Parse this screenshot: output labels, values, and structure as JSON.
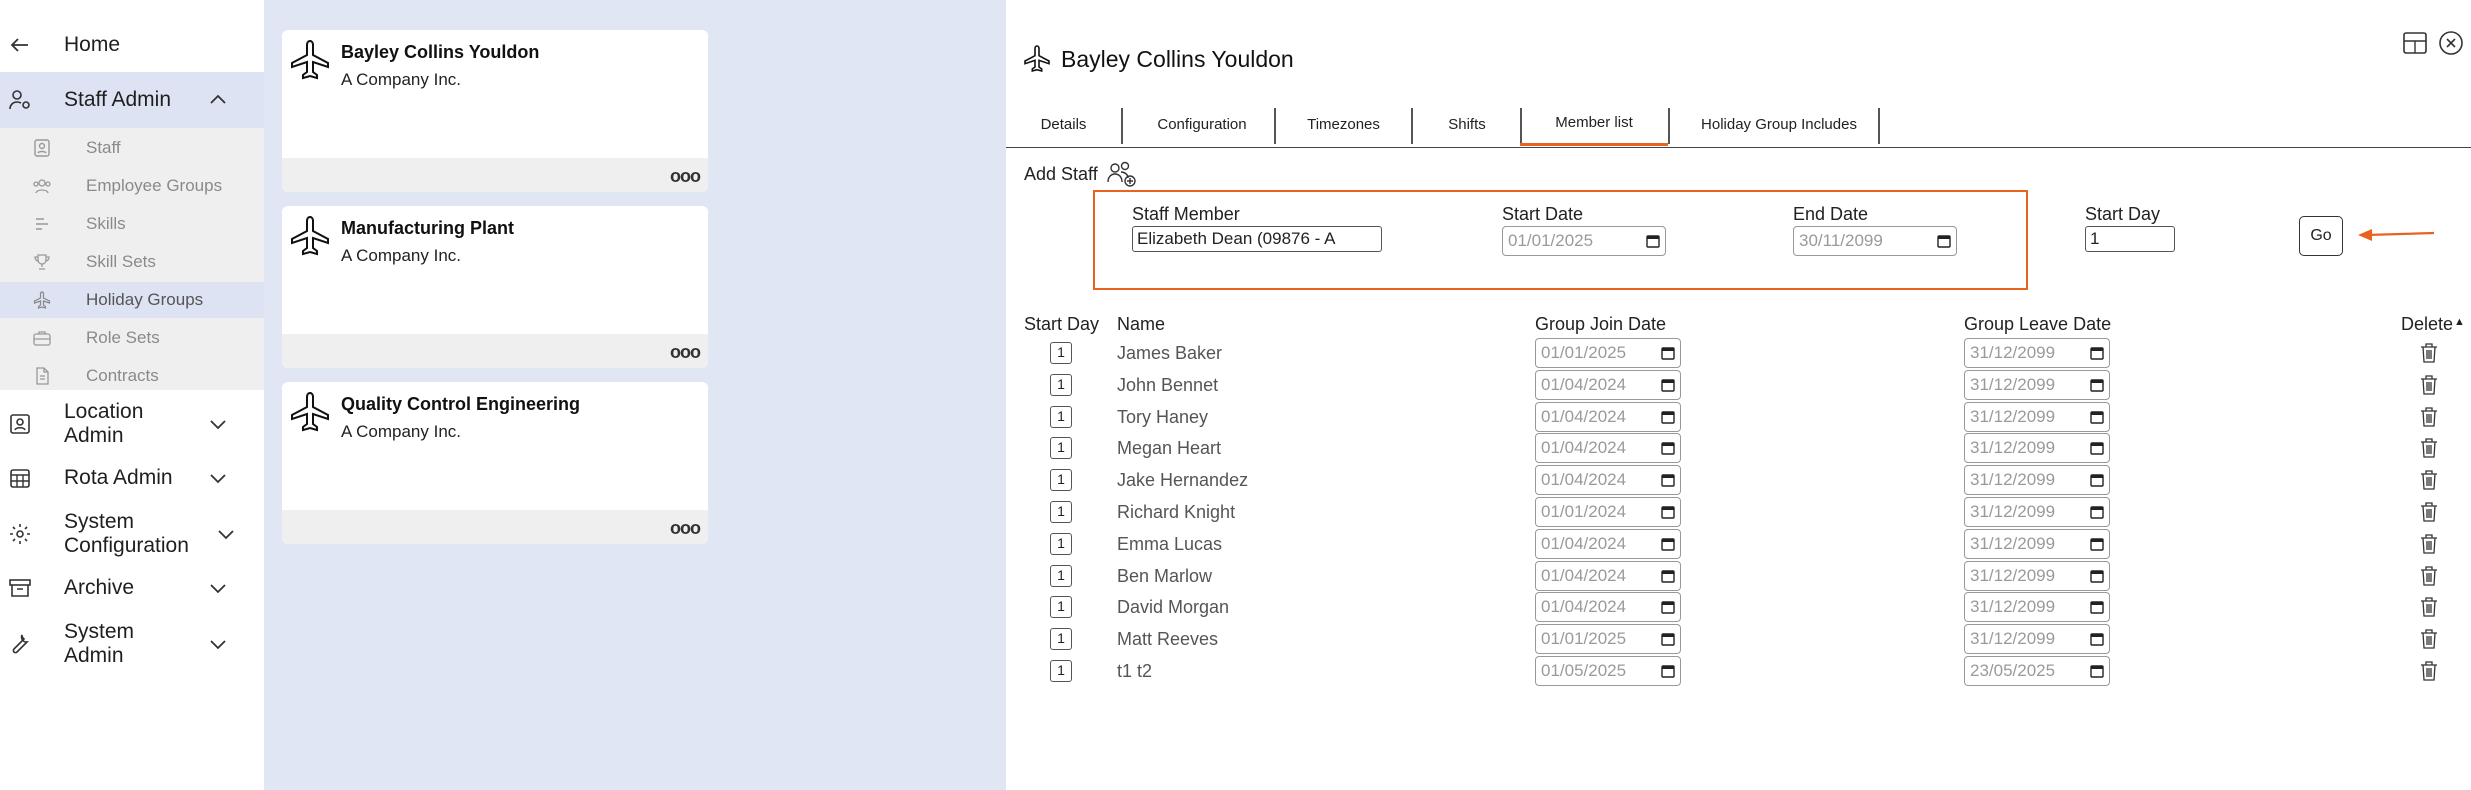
{
  "sidebar": {
    "home": "Home",
    "staff_admin": "Staff Admin",
    "sub_items": [
      {
        "label": "Staff",
        "icon": "id-badge-icon"
      },
      {
        "label": "Employee Groups",
        "icon": "people-group-icon"
      },
      {
        "label": "Skills",
        "icon": "skills-icon"
      },
      {
        "label": "Skill Sets",
        "icon": "trophy-icon"
      },
      {
        "label": "Holiday Groups",
        "icon": "plane-icon"
      },
      {
        "label": "Role Sets",
        "icon": "briefcase-icon"
      },
      {
        "label": "Contracts",
        "icon": "document-icon"
      }
    ],
    "location_admin": "Location Admin",
    "rota_admin": "Rota Admin",
    "system_configuration": "System Configuration",
    "archive": "Archive",
    "system_admin": "System Admin"
  },
  "cards": [
    {
      "title": "Bayley Collins Youldon",
      "company": "A Company Inc."
    },
    {
      "title": "Manufacturing Plant",
      "company": "A Company Inc."
    },
    {
      "title": "Quality Control Engineering",
      "company": "A Company Inc."
    }
  ],
  "detail": {
    "title": "Bayley Collins Youldon",
    "tabs": [
      "Details",
      "Configuration",
      "Timezones",
      "Shifts",
      "Member list",
      "Holiday Group Includes"
    ],
    "active_tab": "Member list",
    "add_staff": "Add Staff",
    "form": {
      "staff_member_label": "Staff Member",
      "staff_member_value": "Elizabeth  Dean (09876 - A",
      "start_date_label": "Start Date",
      "start_date_value": "01/01/2025",
      "end_date_label": "End Date",
      "end_date_value": "30/11/2099",
      "start_day_label": "Start Day",
      "start_day_value": "1",
      "go": "Go"
    },
    "columns": {
      "start_day": "Start Day",
      "name": "Name",
      "join": "Group Join Date",
      "leave": "Group Leave Date",
      "delete": "Delete"
    },
    "members": [
      {
        "start_day": "1",
        "name": "James Baker",
        "join": "01/01/2025",
        "leave": "31/12/2099"
      },
      {
        "start_day": "1",
        "name": "John Bennet",
        "join": "01/04/2024",
        "leave": "31/12/2099"
      },
      {
        "start_day": "1",
        "name": "Tory Haney",
        "join": "01/04/2024",
        "leave": "31/12/2099"
      },
      {
        "start_day": "1",
        "name": "Megan Heart",
        "join": "01/04/2024",
        "leave": "31/12/2099"
      },
      {
        "start_day": "1",
        "name": "Jake Hernandez",
        "join": "01/04/2024",
        "leave": "31/12/2099"
      },
      {
        "start_day": "1",
        "name": "Richard Knight",
        "join": "01/01/2024",
        "leave": "31/12/2099"
      },
      {
        "start_day": "1",
        "name": "Emma Lucas",
        "join": "01/04/2024",
        "leave": "31/12/2099"
      },
      {
        "start_day": "1",
        "name": "Ben Marlow",
        "join": "01/04/2024",
        "leave": "31/12/2099"
      },
      {
        "start_day": "1",
        "name": "David Morgan",
        "join": "01/04/2024",
        "leave": "31/12/2099"
      },
      {
        "start_day": "1",
        "name": "Matt Reeves",
        "join": "01/01/2025",
        "leave": "31/12/2099"
      },
      {
        "start_day": "1",
        "name": "t1 t2",
        "join": "01/05/2025",
        "leave": "23/05/2025"
      }
    ]
  },
  "colors": {
    "accent": "#e8641e",
    "middle_bg": "#e1e6f5",
    "active_sub_bg": "#dde3f3"
  }
}
